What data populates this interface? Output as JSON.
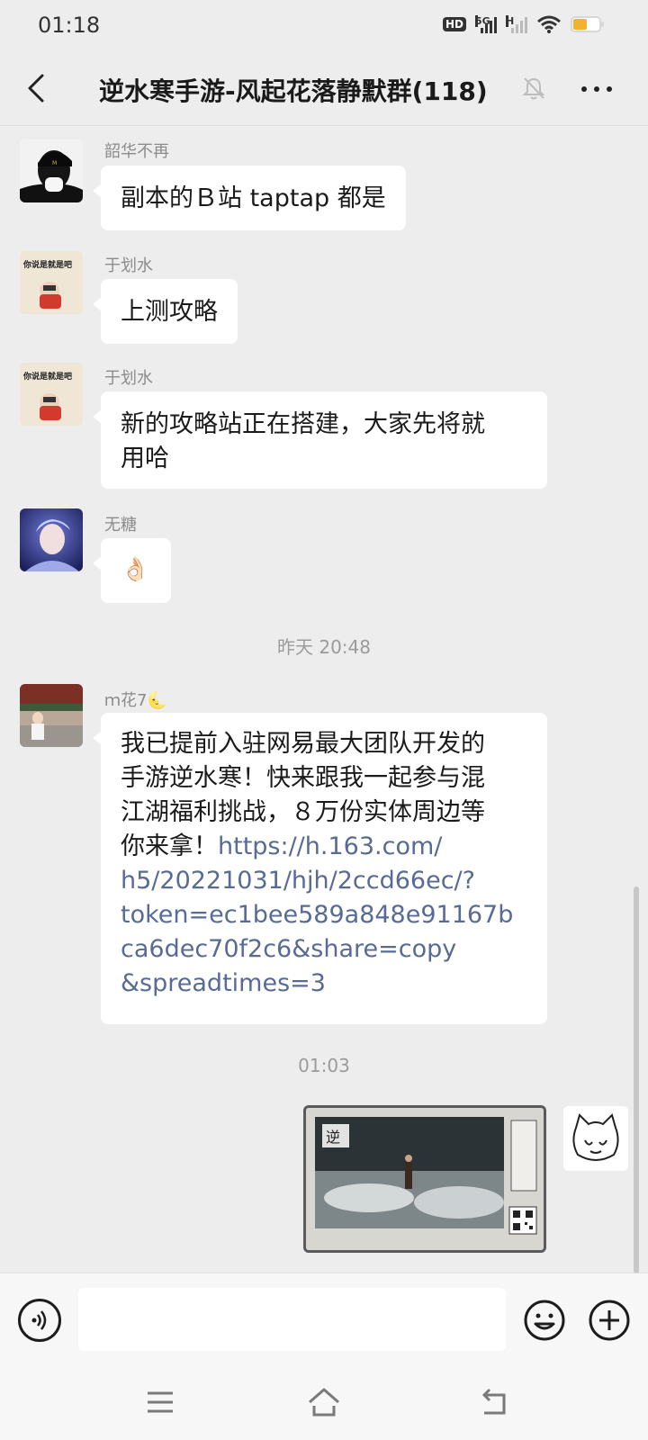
{
  "status_bar": {
    "time": "01:18",
    "hd": "HD",
    "network1": "5G",
    "network2": "H",
    "battery_level": 0.55,
    "battery_color": "#f3b22c"
  },
  "header": {
    "title": "逆水寒手游-风起花落静默群(118)",
    "back_icon": "chevron-left-icon",
    "mute_icon": "bell-off-icon",
    "more_icon": "more-dots-icon"
  },
  "messages": [
    {
      "sender": "韶华不再",
      "text": "副本的Ｂ站 taptap 都是"
    },
    {
      "sender": "于划水",
      "text": "上测攻略",
      "avatar_text": "你说是就是吧"
    },
    {
      "sender": "于划水",
      "text_line1": "新的攻略站正在搭建，大家先将就",
      "text_line2": "用哈",
      "avatar_text": "你说是就是吧"
    },
    {
      "sender": "无糖",
      "text": "👌🏻"
    },
    {
      "sender": "ｍ花7🌜",
      "text": "我已提前入驻网易最大团队开发的手游逆水寒！快来跟我一起参与混江湖福利挑战，８万份实体周边等你来拿！",
      "link": "https://h.163.com/h5/20221031/hjh/2ccd66ec/?token=ec1bee589a848e91167bca6dec70f2c6&share=copy&spreadtimes=3",
      "link_lines": [
        "https://h.163.com/",
        "h5/20221031/hjh/2ccd66ec/?",
        "token=ec1bee589a848e91167b",
        "ca6dec70f2c6&share=copy",
        "&spreadtimes=3"
      ],
      "text_lines": [
        "我已提前入驻网易最大团队开发的",
        "手游逆水寒！快来跟我一起参与混",
        "江湖福利挑战，８万份实体周边等",
        "你来拿！"
      ]
    }
  ],
  "timestamps": {
    "first": "昨天 20:48",
    "second": "01:03"
  },
  "input_bar": {
    "voice_icon": "voice-icon",
    "placeholder": "",
    "emoji_icon": "emoji-icon",
    "plus_icon": "plus-icon"
  },
  "nav_bar": {
    "menu_icon": "menu-icon",
    "home_icon": "home-icon",
    "back_icon": "back-icon"
  },
  "colors": {
    "background": "#ededed",
    "bubble": "#ffffff",
    "link": "#576b95",
    "sender": "#8c8c8c"
  }
}
